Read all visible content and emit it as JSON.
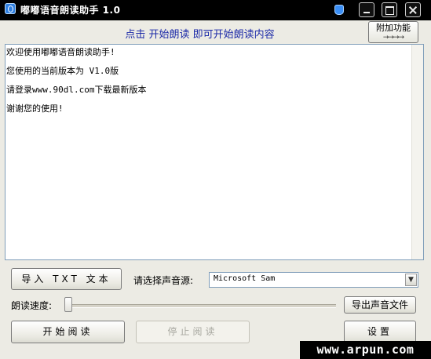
{
  "window": {
    "title": "嘟嘟语音朗读助手 1.0"
  },
  "header": {
    "hint": "点击 开始朗读 即可开始朗读内容",
    "addon_label": "附加功能",
    "addon_arrows": "→→→→"
  },
  "content": {
    "lines": [
      "欢迎使用嘟嘟语音朗读助手!",
      "您使用的当前版本为 V1.0版",
      "请登录www.90dl.com下载最新版本",
      "谢谢您的使用!"
    ]
  },
  "controls": {
    "import_label": "导入 TXT 文本",
    "voice_label": "请选择声音源:",
    "voice_value": "Microsoft Sam",
    "speed_label": "朗读速度:",
    "speed_value": 0,
    "export_label": "导出声音文件",
    "start_label": "开始阅读",
    "stop_label": "停止阅读",
    "settings_label": "设置"
  },
  "watermark": "www.arpun.com"
}
